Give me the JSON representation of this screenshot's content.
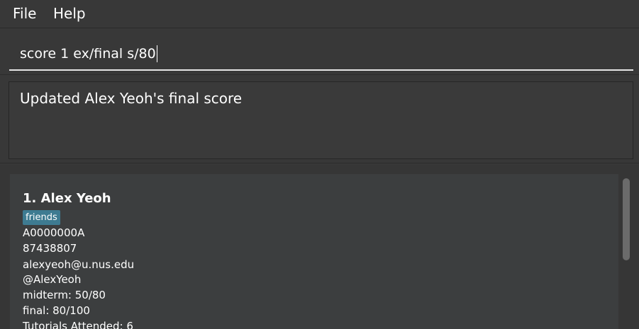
{
  "menu": {
    "file_label": "File",
    "help_label": "Help"
  },
  "command": {
    "value": "score 1 ex/final s/80"
  },
  "result": {
    "message": "Updated Alex Yeoh's final score"
  },
  "persons": [
    {
      "index_name": "1. Alex Yeoh",
      "tags": [
        "friends"
      ],
      "student_id": "A0000000A",
      "phone": "87438807",
      "email": "alexyeoh@u.nus.edu",
      "telegram": "@AlexYeoh",
      "midterm": "midterm: 50/80",
      "final": "final: 80/100",
      "tutorials": "Tutorials Attended: 6"
    }
  ],
  "colors": {
    "background": "#383838",
    "card": "#3c3e3f",
    "tag": "#3e7b91",
    "text": "#ffffff"
  }
}
